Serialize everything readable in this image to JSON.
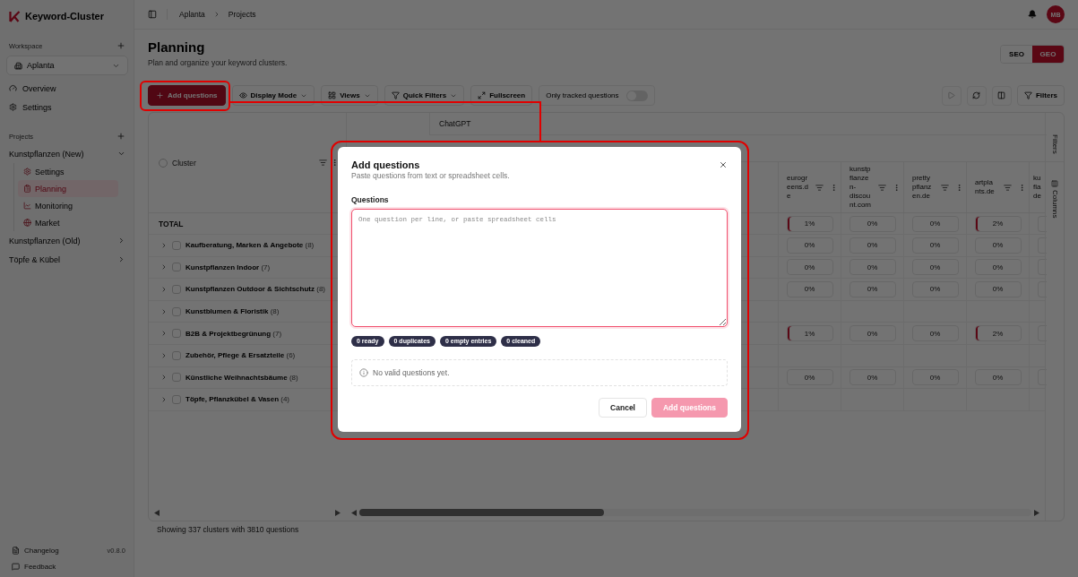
{
  "sidebar": {
    "app_name": "Keyword-Cluster",
    "workspace_label": "Workspace",
    "workspace": "Aplanta",
    "nav": [
      {
        "label": "Overview"
      },
      {
        "label": "Settings"
      }
    ],
    "projects_label": "Projects",
    "projects": [
      {
        "label": "Kunstpflanzen (New)",
        "expanded": true,
        "children": [
          {
            "label": "Settings",
            "selected": false
          },
          {
            "label": "Planning",
            "selected": true
          },
          {
            "label": "Monitoring",
            "selected": false
          },
          {
            "label": "Market",
            "selected": false
          }
        ]
      },
      {
        "label": "Kunstpflanzen (Old)",
        "expanded": false
      },
      {
        "label": "Töpfe & Kübel",
        "expanded": false
      }
    ],
    "changelog": {
      "label": "Changelog",
      "version": "v0.8.0"
    },
    "feedback": "Feedback"
  },
  "header": {
    "breadcrumb": [
      "Aplanta",
      "Projects"
    ],
    "avatar": "MB"
  },
  "page": {
    "title": "Planning",
    "subtitle": "Plan and organize your keyword clusters.",
    "modes": [
      {
        "label": "SEO",
        "selected": false
      },
      {
        "label": "GEO",
        "selected": true
      }
    ]
  },
  "toolbar": {
    "add_button": "Add questions",
    "buttons": [
      {
        "label": "Display Mode",
        "dropdown": true
      },
      {
        "label": "Views",
        "dropdown": true
      },
      {
        "label": "Quick Filters",
        "dropdown": true
      },
      {
        "label": "Fullscreen",
        "dropdown": false
      }
    ],
    "toggle": {
      "label": "Only tracked questions",
      "on": false
    },
    "play_button": {
      "disabled": true
    },
    "filters_button": "Filters"
  },
  "table": {
    "group_header": "ChatGPT",
    "cluster_header": "Cluster",
    "all_selected": false,
    "columns": [
      "eurogreens.de",
      "kunstpflanzen-discount.com",
      "prettypflanzen.de",
      "artplants.de",
      "ku fla de"
    ],
    "total": {
      "label": "TOTAL",
      "values": [
        {
          "text": "1%",
          "marked": true
        },
        {
          "text": "0%",
          "marked": false
        },
        {
          "text": "0%",
          "marked": false
        },
        {
          "text": "2%",
          "marked": true
        }
      ]
    },
    "rows": [
      {
        "name": "**Kaufberatung, Marken & Angebote** (8)",
        "expanded": false,
        "checked": false,
        "values": [
          {
            "text": "0%",
            "marked": false
          },
          {
            "text": "0%",
            "marked": false
          },
          {
            "text": "0%",
            "marked": false
          },
          {
            "text": "0%",
            "marked": false
          }
        ]
      },
      {
        "name": "**Kunstpflanzen Indoor** (7)",
        "expanded": false,
        "checked": false,
        "values": [
          {
            "text": "0%",
            "marked": false
          },
          {
            "text": "0%",
            "marked": false
          },
          {
            "text": "0%",
            "marked": false
          },
          {
            "text": "0%",
            "marked": false
          }
        ]
      },
      {
        "name": "**Kunstpflanzen Outdoor & Sichtschutz** (8)",
        "expanded": false,
        "checked": false,
        "values": [
          {
            "text": "0%",
            "marked": false
          },
          {
            "text": "0%",
            "marked": false
          },
          {
            "text": "0%",
            "marked": false
          },
          {
            "text": "0%",
            "marked": false
          }
        ]
      },
      {
        "name": "**Kunstblumen & Floristik** (8)",
        "expanded": false,
        "checked": false
      },
      {
        "name": "**B2B & Projektbegrünung** (7)",
        "expanded": false,
        "checked": false,
        "values": [
          {
            "text": "1%",
            "marked": true
          },
          {
            "text": "0%",
            "marked": false
          },
          {
            "text": "0%",
            "marked": false
          },
          {
            "text": "2%",
            "marked": true
          }
        ]
      },
      {
        "name": "**Zubehör, Pflege & Ersatzteile** (6)",
        "expanded": false,
        "checked": false
      },
      {
        "name": "**Künstliche Weihnachtsbäume** (8)",
        "expanded": false,
        "checked": false,
        "values": [
          {
            "text": "0%",
            "marked": false
          },
          {
            "text": "0%",
            "marked": false
          },
          {
            "text": "0%",
            "marked": false
          },
          {
            "text": "0%",
            "marked": false
          }
        ]
      },
      {
        "name": "**Töpfe, Pflanzkübel & Vasen** (4)",
        "expanded": false,
        "checked": false
      }
    ],
    "summary": "Showing 337 clusters with 3810 questions"
  },
  "side_tabs": [
    {
      "label": "Filters",
      "kind": "text"
    },
    {
      "label": "Columns",
      "kind": "icon"
    }
  ],
  "dialog": {
    "title": "Add questions",
    "subtitle": "Paste questions from text or spreadsheet cells.",
    "field_label": "Questions",
    "placeholder": "One question per line, or paste spreadsheet cells",
    "stats": [
      "0 ready",
      "0 duplicates",
      "0 empty entries",
      "0 cleaned"
    ],
    "notice": "No valid questions yet.",
    "buttons": [
      {
        "label": "Cancel",
        "kind": "secondary",
        "disabled": false
      },
      {
        "label": "Add questions",
        "kind": "primary",
        "disabled": true
      }
    ]
  }
}
